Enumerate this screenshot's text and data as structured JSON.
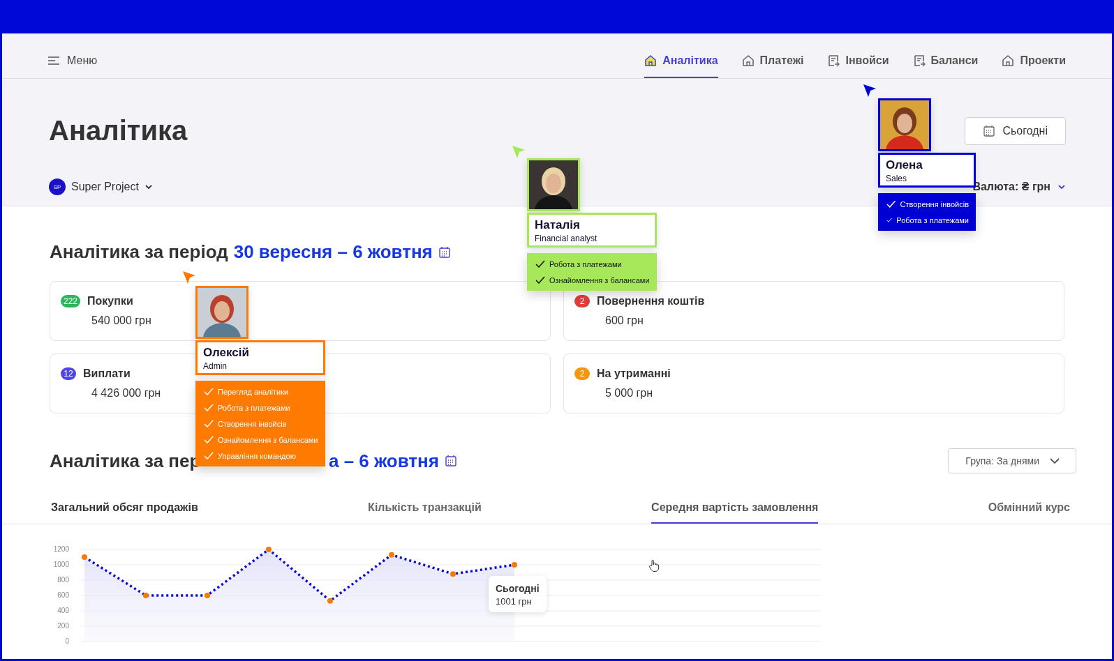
{
  "nav": {
    "menu": "Меню",
    "tabs": [
      {
        "label": "Аналітика",
        "selected": true
      },
      {
        "label": "Платежі",
        "selected": false
      },
      {
        "label": "Інвойси",
        "selected": false
      },
      {
        "label": "Баланси",
        "selected": false
      },
      {
        "label": "Проекти",
        "selected": false
      }
    ]
  },
  "header": {
    "title": "Аналітика",
    "today_button": "Сьогодні",
    "project": {
      "badge": "SP",
      "name": "Super Project"
    },
    "currency": "Валюта: ₴ грн"
  },
  "summary": {
    "heading": "Аналітика за період",
    "period": "30 вересня – 6 жовтня",
    "cards": [
      {
        "count": "222",
        "color": "#2bb65a",
        "label": "Покупки",
        "amount": "540 000 грн"
      },
      {
        "count": "2",
        "color": "#e0403a",
        "label": "Повернення коштів",
        "amount": "600 грн"
      },
      {
        "count": "12",
        "color": "#4f46e5",
        "label": "Виплати",
        "amount": "4 426 000 грн"
      },
      {
        "count": "2",
        "color": "#f5970a",
        "label": "На утриманні",
        "amount": "5 000 грн"
      }
    ]
  },
  "trend": {
    "heading": "Аналітика за пер",
    "period": "а – 6 жовтня",
    "group_select": "Група: За днями",
    "metric_tabs": [
      {
        "label": "Загальний обсяг продажів",
        "selected": false
      },
      {
        "label": "Кількість транзакцій",
        "selected": false
      },
      {
        "label": "Середня вартість замовлення",
        "selected": true
      },
      {
        "label": "Обмінний курс",
        "selected": false
      }
    ],
    "chart_data": {
      "type": "area",
      "grid": true,
      "ylim": [
        0,
        1200
      ],
      "yticks": [
        0,
        200,
        400,
        600,
        800,
        1000,
        1200
      ],
      "series": [
        {
          "color": "#0a0ad0",
          "line_style": "dotted",
          "marker": "o",
          "values": [
            1100,
            600,
            600,
            1200,
            530,
            1130,
            880,
            1000
          ]
        }
      ]
    },
    "tooltip": {
      "title": "Сьогодні",
      "value": "1001 грн"
    }
  },
  "users": [
    {
      "name": "Олексій",
      "role": "Admin",
      "color": "#ff7a00",
      "permissions": [
        "Перегляд аналітики",
        "Робота з платежами",
        "Створення інвойсів",
        "Ознайомлення з балансами",
        "Управління командою"
      ]
    },
    {
      "name": "Наталія",
      "role": "Financial analyst",
      "color": "#a6e85a",
      "permissions": [
        "Робота з платежами",
        "Ознайомлення з балансами"
      ]
    },
    {
      "name": "Олена",
      "role": "Sales",
      "color": "#0000d4",
      "permissions": [
        "Створення інвойсів",
        "Робота з платежами"
      ]
    }
  ]
}
